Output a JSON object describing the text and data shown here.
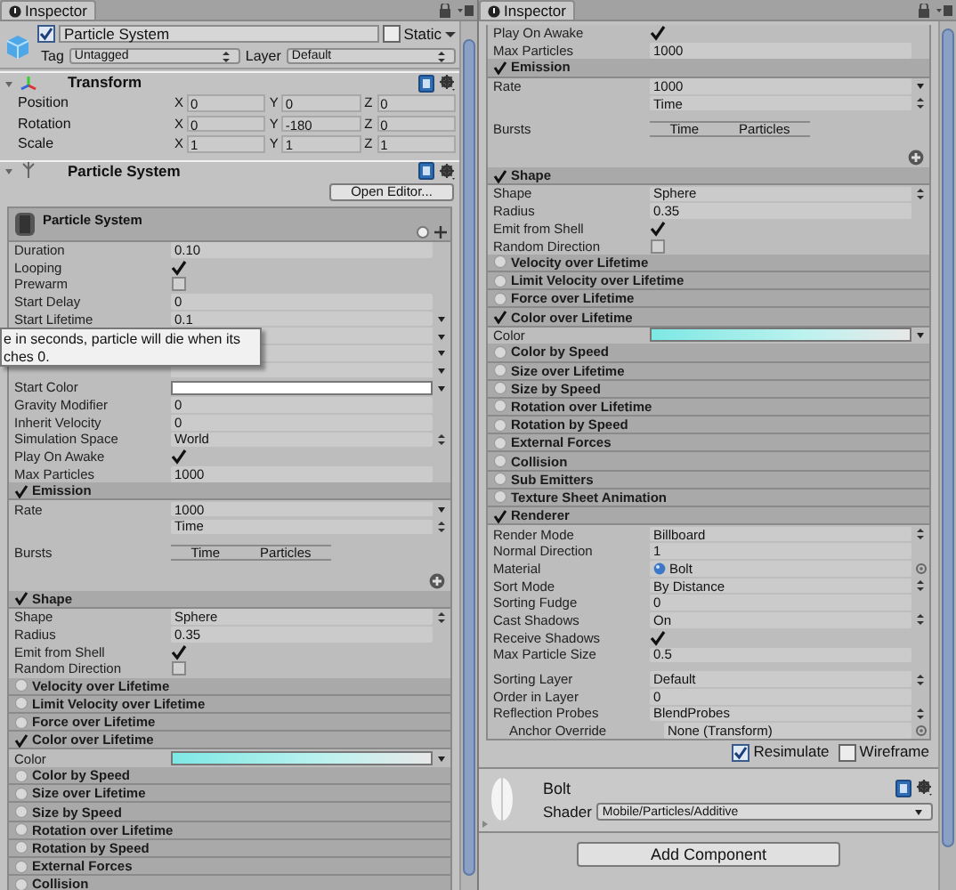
{
  "panels": [
    {
      "tab": "Inspector",
      "object": {
        "enabled": true,
        "name": "Particle System",
        "static_label": "Static",
        "static": false,
        "tag_label": "Tag",
        "tag": "Untagged",
        "layer_label": "Layer",
        "layer": "Default"
      },
      "transform": {
        "title": "Transform",
        "rows": [
          {
            "label": "Position",
            "values": [
              {
                "axis": "X",
                "value": "0"
              },
              {
                "axis": "Y",
                "value": "0"
              },
              {
                "axis": "Z",
                "value": "0"
              }
            ]
          },
          {
            "label": "Rotation",
            "values": [
              {
                "axis": "X",
                "value": "0"
              },
              {
                "axis": "Y",
                "value": "-180"
              },
              {
                "axis": "Z",
                "value": "0"
              }
            ]
          },
          {
            "label": "Scale",
            "values": [
              {
                "axis": "X",
                "value": "1"
              },
              {
                "axis": "Y",
                "value": "1"
              },
              {
                "axis": "Z",
                "value": "1"
              }
            ]
          }
        ]
      },
      "component": {
        "title": "Particle System",
        "button": "Open Editor..."
      },
      "system_title": "Particle System",
      "tooltip": [
        "e in seconds, particle will die when its",
        "ches 0."
      ],
      "rows": [
        {
          "kind": "number",
          "label": "Duration",
          "value": "0.10"
        },
        {
          "kind": "checkbox",
          "label": "Looping",
          "checked": true
        },
        {
          "kind": "checkbox",
          "label": "Prewarm",
          "checked": false
        },
        {
          "kind": "number",
          "label": "Start Delay",
          "value": "0"
        },
        {
          "kind": "curve",
          "label": "Start Lifetime",
          "value": "0.1"
        },
        {
          "kind": "hiddencurve"
        },
        {
          "kind": "hiddencurve"
        },
        {
          "kind": "hiddencurve"
        },
        {
          "kind": "colorswatch",
          "label": "Start Color"
        },
        {
          "kind": "number",
          "label": "Gravity Modifier",
          "value": "0"
        },
        {
          "kind": "number",
          "label": "Inherit Velocity",
          "value": "0"
        },
        {
          "kind": "dropdown",
          "label": "Simulation Space",
          "value": "World"
        },
        {
          "kind": "checkbox",
          "label": "Play On Awake",
          "checked": true
        },
        {
          "kind": "number",
          "label": "Max Particles",
          "value": "1000"
        },
        {
          "kind": "module",
          "label": "Emission",
          "enabled": true
        },
        {
          "kind": "curve",
          "label": "Rate",
          "value": "1000"
        },
        {
          "kind": "dropdown",
          "value": "Time"
        },
        {
          "kind": "bursts",
          "label": "Bursts",
          "columns": [
            "Time",
            "Particles"
          ]
        },
        {
          "kind": "add"
        },
        {
          "kind": "module",
          "label": "Shape",
          "enabled": true
        },
        {
          "kind": "dropdown",
          "label": "Shape",
          "value": "Sphere"
        },
        {
          "kind": "number",
          "label": "Radius",
          "value": "0.35"
        },
        {
          "kind": "checkbox",
          "label": "Emit from Shell",
          "checked": true
        },
        {
          "kind": "checkbox",
          "label": "Random Direction",
          "checked": false
        },
        {
          "kind": "module",
          "label": "Velocity over Lifetime",
          "enabled": false
        },
        {
          "kind": "module",
          "label": "Limit Velocity over Lifetime",
          "enabled": false
        },
        {
          "kind": "module",
          "label": "Force over Lifetime",
          "enabled": false
        },
        {
          "kind": "module",
          "label": "Color over Lifetime",
          "enabled": true
        },
        {
          "kind": "gradient",
          "label": "Color"
        },
        {
          "kind": "module",
          "label": "Color by Speed",
          "enabled": false
        },
        {
          "kind": "module",
          "label": "Size over Lifetime",
          "enabled": false
        },
        {
          "kind": "module",
          "label": "Size by Speed",
          "enabled": false
        },
        {
          "kind": "module",
          "label": "Rotation over Lifetime",
          "enabled": false
        },
        {
          "kind": "module",
          "label": "Rotation by Speed",
          "enabled": false
        },
        {
          "kind": "module",
          "label": "External Forces",
          "enabled": false
        },
        {
          "kind": "module",
          "label": "Collision",
          "enabled": false
        }
      ]
    },
    {
      "tab": "Inspector",
      "rows": [
        {
          "kind": "checkbox",
          "label": "Play On Awake",
          "checked": true
        },
        {
          "kind": "number",
          "label": "Max Particles",
          "value": "1000"
        },
        {
          "kind": "module",
          "label": "Emission",
          "enabled": true
        },
        {
          "kind": "curve",
          "label": "Rate",
          "value": "1000"
        },
        {
          "kind": "dropdown",
          "value": "Time"
        },
        {
          "kind": "bursts",
          "label": "Bursts",
          "columns": [
            "Time",
            "Particles"
          ]
        },
        {
          "kind": "add"
        },
        {
          "kind": "module",
          "label": "Shape",
          "enabled": true
        },
        {
          "kind": "dropdown",
          "label": "Shape",
          "value": "Sphere"
        },
        {
          "kind": "number",
          "label": "Radius",
          "value": "0.35"
        },
        {
          "kind": "checkbox",
          "label": "Emit from Shell",
          "checked": true
        },
        {
          "kind": "checkbox",
          "label": "Random Direction",
          "checked": false
        },
        {
          "kind": "module",
          "label": "Velocity over Lifetime",
          "enabled": false
        },
        {
          "kind": "module",
          "label": "Limit Velocity over Lifetime",
          "enabled": false
        },
        {
          "kind": "module",
          "label": "Force over Lifetime",
          "enabled": false
        },
        {
          "kind": "module",
          "label": "Color over Lifetime",
          "enabled": true
        },
        {
          "kind": "gradient",
          "label": "Color"
        },
        {
          "kind": "module",
          "label": "Color by Speed",
          "enabled": false
        },
        {
          "kind": "module",
          "label": "Size over Lifetime",
          "enabled": false
        },
        {
          "kind": "module",
          "label": "Size by Speed",
          "enabled": false
        },
        {
          "kind": "module",
          "label": "Rotation over Lifetime",
          "enabled": false
        },
        {
          "kind": "module",
          "label": "Rotation by Speed",
          "enabled": false
        },
        {
          "kind": "module",
          "label": "External Forces",
          "enabled": false
        },
        {
          "kind": "module",
          "label": "Collision",
          "enabled": false
        },
        {
          "kind": "module",
          "label": "Sub Emitters",
          "enabled": false
        },
        {
          "kind": "module",
          "label": "Texture Sheet Animation",
          "enabled": false
        },
        {
          "kind": "module",
          "label": "Renderer",
          "enabled": true
        },
        {
          "kind": "dropdown",
          "label": "Render Mode",
          "value": "Billboard"
        },
        {
          "kind": "number",
          "label": "Normal Direction",
          "value": "1"
        },
        {
          "kind": "materialfield",
          "label": "Material",
          "value": "Bolt"
        },
        {
          "kind": "dropdown",
          "label": "Sort Mode",
          "value": "By Distance"
        },
        {
          "kind": "number",
          "label": "Sorting Fudge",
          "value": "0"
        },
        {
          "kind": "dropdown",
          "label": "Cast Shadows",
          "value": "On"
        },
        {
          "kind": "checkbox",
          "label": "Receive Shadows",
          "checked": true
        },
        {
          "kind": "number",
          "label": "Max Particle Size",
          "value": "0.5"
        },
        {
          "kind": "gap"
        },
        {
          "kind": "dropdown",
          "label": "Sorting Layer",
          "value": "Default"
        },
        {
          "kind": "number",
          "label": "Order in Layer",
          "value": "0"
        },
        {
          "kind": "dropdown",
          "label": "Reflection Probes",
          "value": "BlendProbes"
        },
        {
          "kind": "objectfield",
          "label": "Anchor Override",
          "value": "None (Transform)",
          "indent": true
        }
      ],
      "toggles": [
        {
          "label": "Resimulate",
          "checked": true
        },
        {
          "label": "Wireframe",
          "checked": false
        }
      ],
      "material": {
        "name": "Bolt",
        "shader_label": "Shader",
        "shader": "Mobile/Particles/Additive"
      },
      "button": "Add Component"
    }
  ]
}
